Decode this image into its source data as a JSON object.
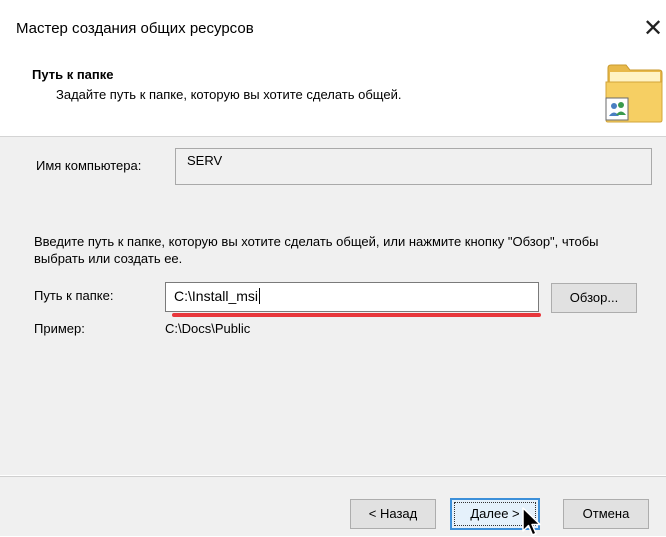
{
  "window": {
    "title": "Мастер создания общих ресурсов",
    "close_glyph": "✕"
  },
  "header": {
    "title": "Путь к папке",
    "subtitle": "Задайте путь к папке, которую вы хотите сделать общей.",
    "icon": "shared-folder-icon"
  },
  "form": {
    "computer_name_label": "Имя компьютера:",
    "computer_name_value": "SERV",
    "instructions": "Введите путь к папке, которую вы хотите сделать общей, или нажмите кнопку \"Обзор\", чтобы выбрать или создать ее.",
    "path_label": "Путь к папке:",
    "path_value": "C:\\Install_msi",
    "browse_label": "Обзор...",
    "example_label": "Пример:",
    "example_value": "C:\\Docs\\Public"
  },
  "footer": {
    "back_label": "< Назад",
    "next_label": "Далее >",
    "cancel_label": "Отмена"
  },
  "colors": {
    "highlight_underline": "#e8373c",
    "default_button_border": "#3c8fd9"
  }
}
